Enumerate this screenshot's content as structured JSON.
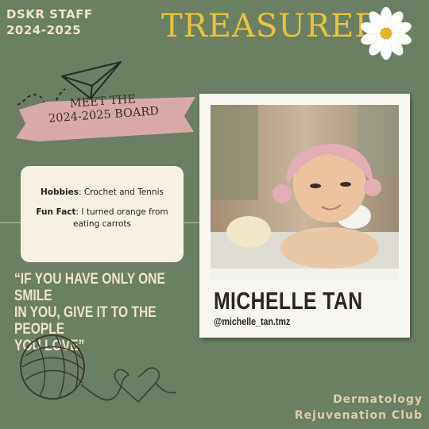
{
  "header": {
    "staff_line1": "DSKR STAFF",
    "staff_line2": "2024-2025",
    "role_title": "TREASURER"
  },
  "banner": {
    "line1": "MEET THE",
    "line2": "2024-2025 BOARD"
  },
  "info_card": {
    "hobbies_label": "Hobbies",
    "hobbies_value": ": Crochet and Tennis",
    "funfact_label": "Fun Fact",
    "funfact_value": ": I turned orange from eating carrots"
  },
  "quote": {
    "line1": "“IF YOU HAVE ONLY ONE SMILE",
    "line2": "IN YOU, GIVE IT TO THE PEOPLE",
    "line3": "YOU LOVE”"
  },
  "profile": {
    "name": "MICHELLE TAN",
    "handle": "@michelle_tan.tmz"
  },
  "footer": {
    "club_line1": "Dermatology",
    "club_line2": "Rejuvenation Club"
  },
  "colors": {
    "background": "#6b8062",
    "title_gold": "#e8c23a",
    "ribbon_pink": "#d9a9a6",
    "card_cream": "#f6f1e2"
  },
  "icons": [
    "daisy-icon",
    "paper-plane-icon",
    "yarn-ball-icon",
    "heart-icon"
  ]
}
